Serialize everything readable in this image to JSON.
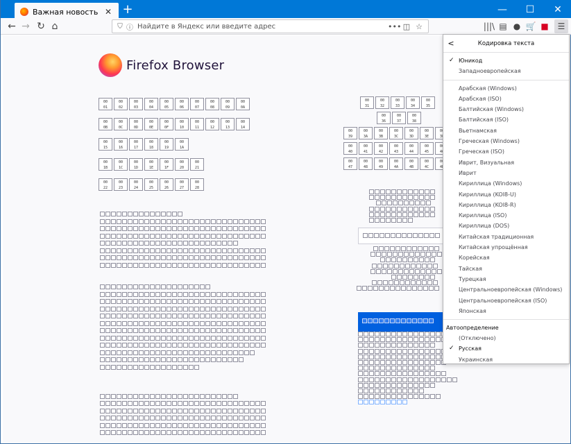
{
  "window": {
    "minimize": "—",
    "maximize": "☐",
    "close": "✕"
  },
  "tab": {
    "title": "Важная новость",
    "close": "✕",
    "new_tab": "+"
  },
  "nav": {
    "back": "←",
    "forward": "→",
    "reload": "↻",
    "home": "⌂"
  },
  "urlbar": {
    "placeholder": "Найдите в Яндекс или введите адрес",
    "more": "•••",
    "pocket": "◫",
    "bookmark": "☆"
  },
  "toolbar": {
    "library": "|||\\",
    "sidebar": "▤",
    "account": "●",
    "cart": "🛒",
    "flag": "■",
    "menu": "☰"
  },
  "page": {
    "logo_text": "Firefox Browser",
    "glyph_grid_left": [
      [
        "00\n01",
        "00\n02",
        "00\n03",
        "00\n04",
        "00\n05",
        "00\n06",
        "00\n07",
        "00\n08",
        "00\n09",
        "00\n0A"
      ],
      [
        "00\n0B",
        "00\n0C",
        "00\n0D",
        "00\n0E",
        "00\n0F",
        "00\n10",
        "00\n11",
        "00\n12",
        "00\n13",
        "00\n14"
      ],
      [
        "00\n15",
        "00\n16",
        "00\n17",
        "00\n18",
        "00\n19",
        "00\n1A"
      ],
      [
        "00\n1B",
        "00\n1C",
        "00\n1D",
        "00\n1E",
        "00\n1F",
        "00\n20",
        "00\n21"
      ],
      [
        "00\n22",
        "00\n23",
        "00\n24",
        "00\n25",
        "00\n26",
        "00\n27",
        "00\n28"
      ]
    ],
    "glyph_grid_right": [
      [
        "00\n31",
        "00\n32",
        "00\n33",
        "00\n34",
        "00\n35"
      ],
      [
        "00\n36",
        "00\n37",
        "00\n38"
      ],
      [
        "00\n39",
        "00\n3A",
        "00\n3B",
        "00\n3C",
        "00\n3D",
        "00\n3E",
        "00\n3F"
      ],
      [
        "00\n40",
        "00\n41",
        "00\n42",
        "00\n43",
        "00\n44",
        "00\n45",
        "00\n46"
      ],
      [
        "00\n47",
        "00\n48",
        "00\n49",
        "00\n4A",
        "00\n4B",
        "00\n4C",
        "00\n4D"
      ]
    ]
  },
  "encoding_panel": {
    "title": "Кодировка текста",
    "back": "<",
    "group1": [
      {
        "label": "Юникод",
        "checked": true
      },
      {
        "label": "Западноевропейская",
        "checked": false
      }
    ],
    "group2": [
      {
        "label": "Арабская (Windows)"
      },
      {
        "label": "Арабская (ISO)"
      },
      {
        "label": "Балтийская (Windows)"
      },
      {
        "label": "Балтийская (ISO)"
      },
      {
        "label": "Вьетнамская"
      },
      {
        "label": "Греческая (Windows)"
      },
      {
        "label": "Греческая (ISO)"
      },
      {
        "label": "Иврит, Визуальная"
      },
      {
        "label": "Иврит"
      },
      {
        "label": "Кириллица (Windows)"
      },
      {
        "label": "Кириллица (KOI8-U)"
      },
      {
        "label": "Кириллица (KOI8-R)"
      },
      {
        "label": "Кириллица (ISO)"
      },
      {
        "label": "Кириллица (DOS)"
      },
      {
        "label": "Китайская традиционная"
      },
      {
        "label": "Китайская упрощённая"
      },
      {
        "label": "Корейская"
      },
      {
        "label": "Тайская"
      },
      {
        "label": "Турецкая"
      },
      {
        "label": "Центральноевропейская (Windows)"
      },
      {
        "label": "Центральноевропейская (ISO)"
      },
      {
        "label": "Японская"
      }
    ],
    "auto_header": "Автоопределение",
    "group3": [
      {
        "label": "(Отключено)",
        "checked": false
      },
      {
        "label": "Русская",
        "checked": true
      },
      {
        "label": "Украинская",
        "checked": false
      }
    ]
  }
}
